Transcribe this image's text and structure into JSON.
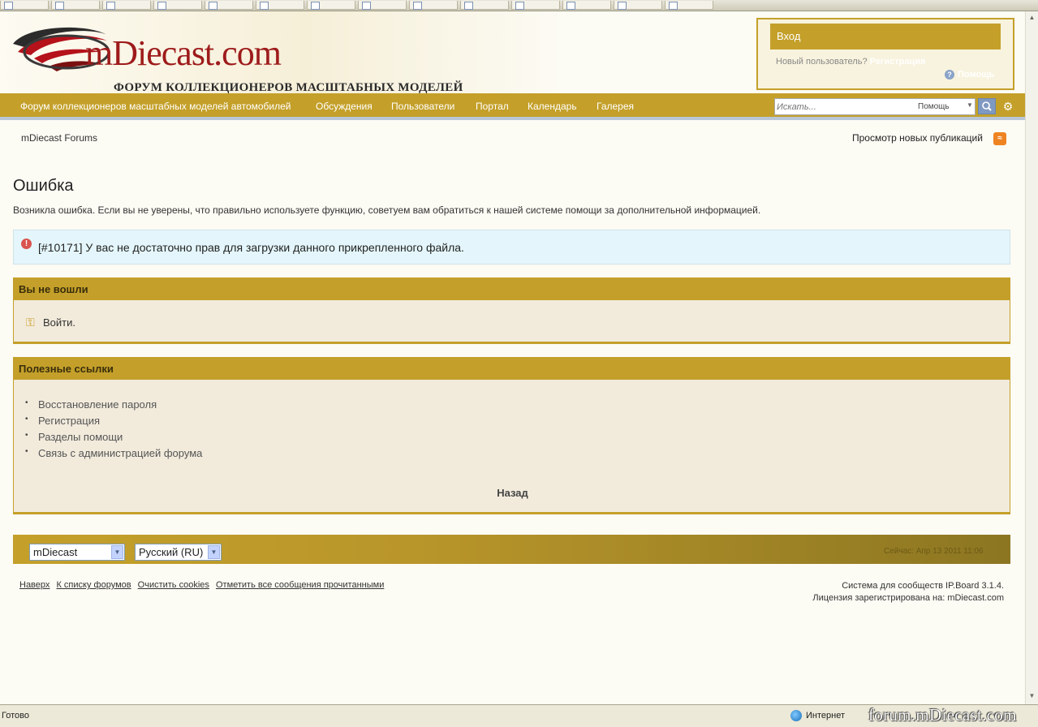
{
  "header": {
    "logo_text": "mDiecast.com",
    "logo_subtitle": "ФОРУМ КОЛЛЕКЦИОНЕРОВ МАСШТАБНЫХ МОДЕЛЕЙ"
  },
  "userbox": {
    "login_label": "Вход",
    "new_user_text": "Новый пользователь?",
    "register_label": "Регистрация",
    "help_label": "Помощь"
  },
  "nav": {
    "items": [
      "Форум коллекционеров масштабных моделей автомобилей",
      "Обсуждения",
      "Пользователи",
      "Портал",
      "Календарь",
      "Галерея"
    ],
    "search_placeholder": "Искать...",
    "search_scope": "Помощь"
  },
  "breadcrumb": {
    "root": "mDiecast Forums",
    "new_posts": "Просмотр новых публикаций"
  },
  "error": {
    "title": "Ошибка",
    "description": "Возникла ошибка. Если вы не уверены, что правильно используете функцию, советуем вам обратиться к нашей системе помощи за дополнительной информацией.",
    "message": "[#10171] У вас не достаточно прав для загрузки данного прикрепленного файла."
  },
  "login_panel": {
    "title": "Вы не вошли",
    "login_link": "Войти."
  },
  "links_panel": {
    "title": "Полезные ссылки",
    "links": [
      "Восстановление пароля",
      "Регистрация",
      "Разделы помощи",
      "Связь с администрацией форума"
    ],
    "back_label": "Назад"
  },
  "footer": {
    "skin": "mDiecast",
    "language": "Русский (RU)",
    "time": "Сейчас: Апр 13 2011 11:06",
    "links": [
      "Наверх",
      "К списку форумов",
      "Очистить cookies",
      "Отметить все сообщения прочитанными"
    ],
    "powered_by": "Система для сообществ IP.Board 3.1.4.",
    "license": "Лицензия зарегистрирована на: mDiecast.com"
  },
  "statusbar": {
    "status": "Готово",
    "zone": "Интернет",
    "watermark": "forum.mDiecast.com"
  },
  "colors": {
    "accent": "#c4a02a",
    "error_bg": "#e4f6fb",
    "panel_bg": "#f2ebdc"
  }
}
